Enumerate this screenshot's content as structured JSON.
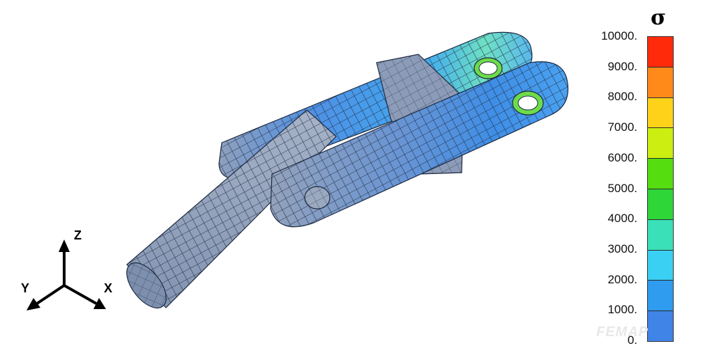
{
  "legend": {
    "title": "σ",
    "labels": [
      "10000.",
      "9000.",
      "8000.",
      "7000.",
      "6000.",
      "5000.",
      "4000.",
      "3000.",
      "2000.",
      "1000.",
      "0."
    ],
    "segment_colors": [
      "#ff2a0a",
      "#ff8a1a",
      "#ffd21a",
      "#ccee10",
      "#55dd10",
      "#2ed638",
      "#3ae0b8",
      "#3ad0f4",
      "#2f9cf0",
      "#3f84e6",
      "#8d9cb8"
    ]
  },
  "axes": {
    "z": "Z",
    "y": "Y",
    "x": "X"
  },
  "watermark": "FEMAP",
  "colors": {
    "grey_mesh": "#8fa0b8",
    "blue_mesh": "#4a8ee8",
    "mesh_line": "#1e2a40",
    "hole_green": "#6cdc4a"
  }
}
